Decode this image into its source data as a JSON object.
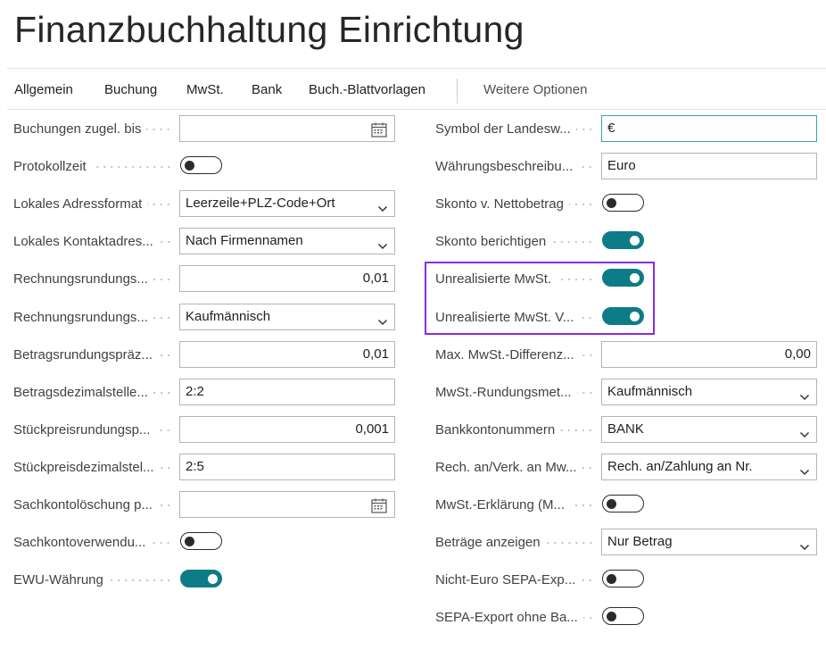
{
  "page": {
    "title": "Finanzbuchhaltung Einrichtung"
  },
  "nav": {
    "items": [
      "Allgemein",
      "Buchung",
      "MwSt.",
      "Bank",
      "Buch.-Blattvorlagen"
    ],
    "more": "Weitere Optionen"
  },
  "left": [
    {
      "label": "Buchungen zugel. bis",
      "type": "date",
      "value": ""
    },
    {
      "label": "Protokollzeit",
      "type": "toggle",
      "on": false
    },
    {
      "label": "Lokales Adressformat",
      "type": "select",
      "value": "Leerzeile+PLZ-Code+Ort"
    },
    {
      "label": "Lokales Kontaktadres...",
      "type": "select",
      "value": "Nach Firmennamen"
    },
    {
      "label": "Rechnungsrundungs...",
      "type": "number",
      "value": "0,01"
    },
    {
      "label": "Rechnungsrundungs...",
      "type": "select",
      "value": "Kaufmännisch"
    },
    {
      "label": "Betragsrundungspräz...",
      "type": "number",
      "value": "0,01"
    },
    {
      "label": "Betragsdezimalstelle...",
      "type": "text",
      "value": "2:2"
    },
    {
      "label": "Stückpreisrundungsp...",
      "type": "number",
      "value": "0,001"
    },
    {
      "label": "Stückpreisdezimalstel...",
      "type": "text",
      "value": "2:5"
    },
    {
      "label": "Sachkontolöschung p...",
      "type": "date",
      "value": ""
    },
    {
      "label": "Sachkontoverwendu...",
      "type": "toggle",
      "on": false
    },
    {
      "label": "EWU-Währung",
      "type": "toggle",
      "on": true
    }
  ],
  "right": [
    {
      "label": "Symbol der Landesw...",
      "type": "text",
      "value": "€",
      "focused": true
    },
    {
      "label": "Währungsbeschreibu...",
      "type": "text",
      "value": "Euro"
    },
    {
      "label": "Skonto v. Nettobetrag",
      "type": "toggle",
      "on": false
    },
    {
      "label": "Skonto berichtigen",
      "type": "toggle",
      "on": true
    },
    {
      "label": "Unrealisierte MwSt.",
      "type": "toggle",
      "on": true
    },
    {
      "label": "Unrealisierte MwSt. V...",
      "type": "toggle",
      "on": true
    },
    {
      "label": "Max. MwSt.-Differenz...",
      "type": "number",
      "value": "0,00"
    },
    {
      "label": "MwSt.-Rundungsmet...",
      "type": "select",
      "value": "Kaufmännisch"
    },
    {
      "label": "Bankkontonummern",
      "type": "select",
      "value": "BANK"
    },
    {
      "label": "Rech. an/Verk. an Mw...",
      "type": "select",
      "value": "Rech. an/Zahlung an Nr."
    },
    {
      "label": "MwSt.-Erklärung (M...",
      "type": "toggle",
      "on": false
    },
    {
      "label": "Beträge anzeigen",
      "type": "select",
      "value": "Nur Betrag"
    },
    {
      "label": "Nicht-Euro SEPA-Exp...",
      "type": "toggle",
      "on": false
    },
    {
      "label": "SEPA-Export ohne Ba...",
      "type": "toggle",
      "on": false
    }
  ],
  "colors": {
    "accent": "#0e7c86",
    "highlight": "#8a2be2",
    "focus": "#34a6a6"
  }
}
